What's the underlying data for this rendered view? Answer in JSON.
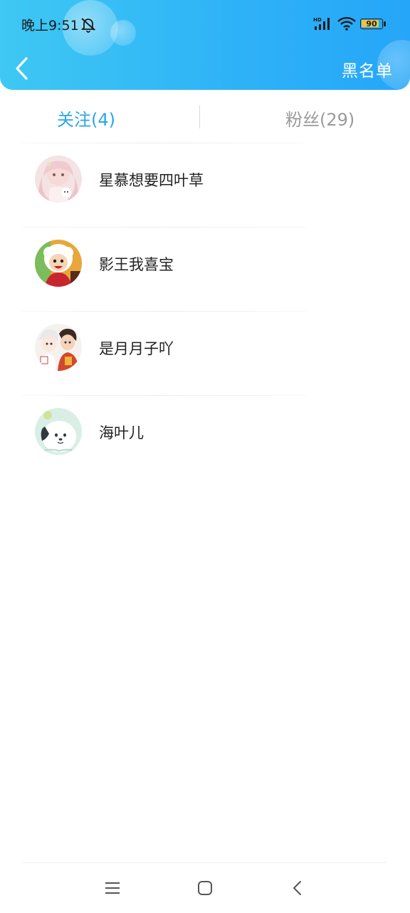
{
  "status_bar": {
    "time": "晚上9:51",
    "battery_level": "90",
    "battery_fraction": 0.9
  },
  "header": {
    "blacklist_label": "黑名单",
    "accent_color": "#2fb3f7"
  },
  "tabs": [
    {
      "label": "关注(4)",
      "active": true
    },
    {
      "label": "粉丝(29)",
      "active": false
    }
  ],
  "users": [
    {
      "name": "星慕想要四叶草",
      "avatar": "anime-girl-pink-avatar"
    },
    {
      "name": "影王我喜宝",
      "avatar": "cartoon-sheep-avatar"
    },
    {
      "name": "是月月子吖",
      "avatar": "anime-couple-avatar"
    },
    {
      "name": "海叶儿",
      "avatar": "pochacco-dog-avatar"
    }
  ],
  "nav_bar": {
    "icons": [
      "menu-icon",
      "home-icon",
      "back-icon"
    ]
  }
}
